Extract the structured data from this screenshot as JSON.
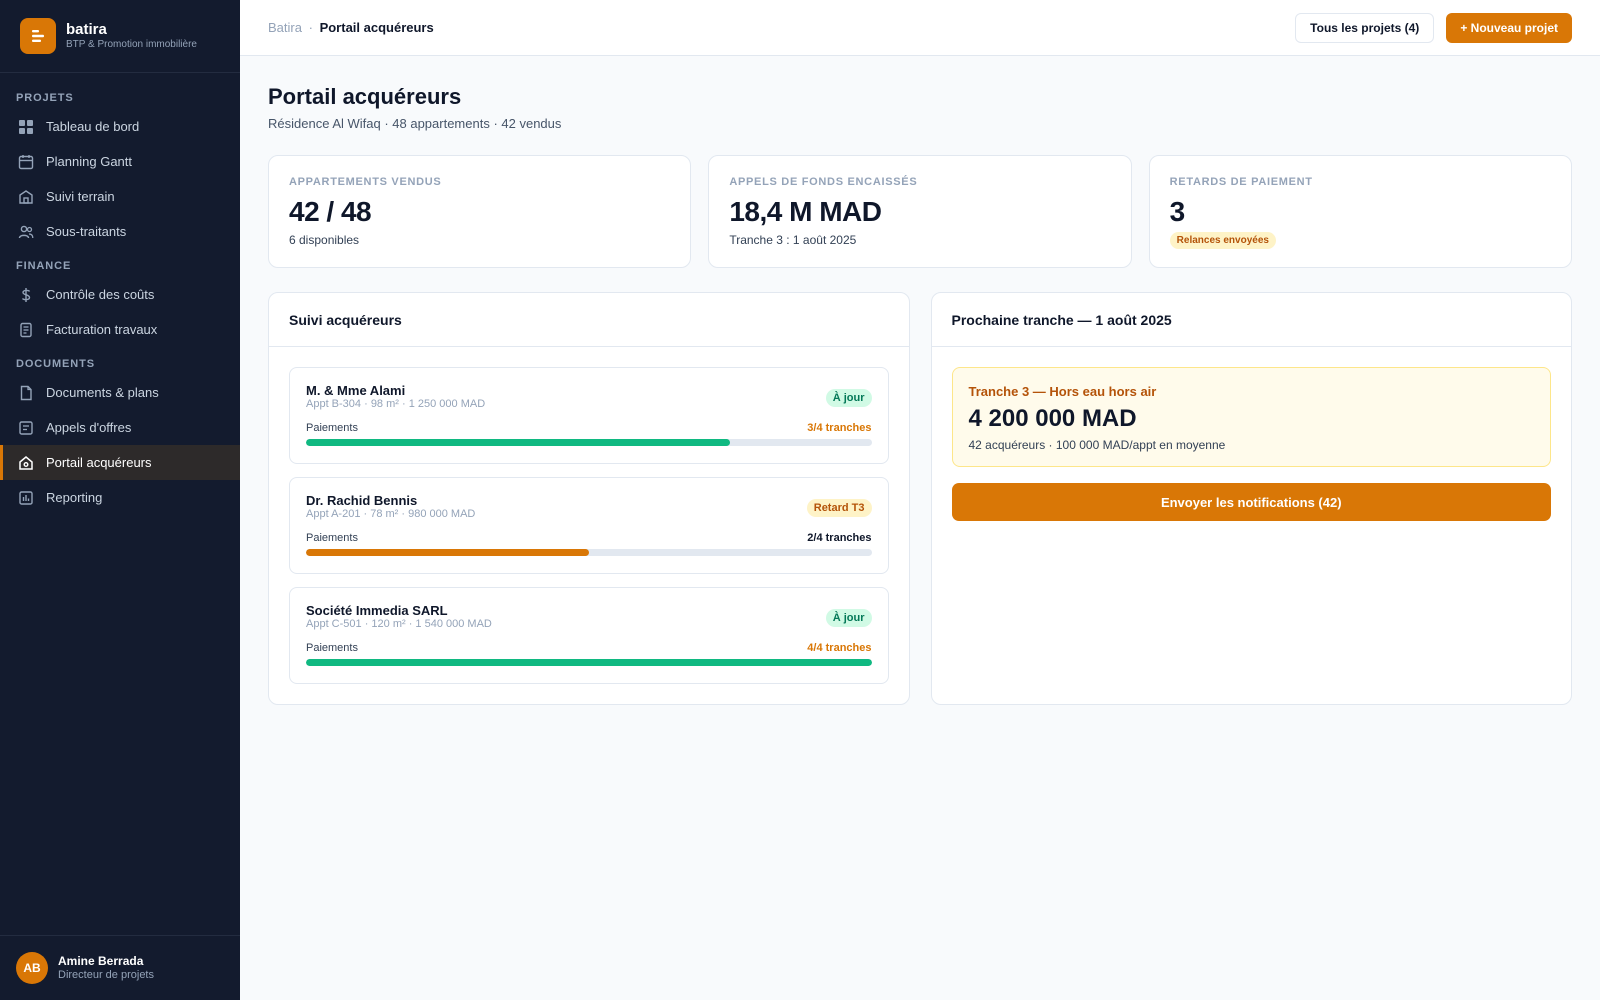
{
  "brand": {
    "name": "batira",
    "tagline": "BTP & Promotion immobilière",
    "accent": "#d97706"
  },
  "sidebar": {
    "sections": [
      {
        "title": "PROJETS",
        "items": [
          {
            "label": "Tableau de bord",
            "icon": "grid-icon"
          },
          {
            "label": "Planning Gantt",
            "icon": "calendar-icon"
          },
          {
            "label": "Suivi terrain",
            "icon": "building-icon"
          },
          {
            "label": "Sous-traitants",
            "icon": "users-icon"
          }
        ]
      },
      {
        "title": "FINANCE",
        "items": [
          {
            "label": "Contrôle des coûts",
            "icon": "currency-icon"
          },
          {
            "label": "Facturation travaux",
            "icon": "invoice-icon"
          }
        ]
      },
      {
        "title": "DOCUMENTS",
        "items": [
          {
            "label": "Documents & plans",
            "icon": "file-icon"
          },
          {
            "label": "Appels d'offres",
            "icon": "form-icon"
          },
          {
            "label": "Portail acquéreurs",
            "icon": "home-icon",
            "active": true
          },
          {
            "label": "Reporting",
            "icon": "chart-icon"
          }
        ]
      }
    ]
  },
  "user": {
    "initials": "AB",
    "name": "Amine Berrada",
    "role": "Directeur de projets"
  },
  "topbar": {
    "breadcrumb_root": "Batira",
    "breadcrumb_sep": "·",
    "breadcrumb_current": "Portail acquéreurs",
    "all_projects_label": "Tous les projets (4)",
    "new_project_label": "+ Nouveau projet"
  },
  "page": {
    "title": "Portail acquéreurs",
    "subtitle": "Résidence Al Wifaq · 48 appartements · 42 vendus"
  },
  "kpis": [
    {
      "label": "APPARTEMENTS VENDUS",
      "value": "42 / 48",
      "note": "6 disponibles"
    },
    {
      "label": "APPELS DE FONDS ENCAISSÉS",
      "value": "18,4 M MAD",
      "note": "Tranche 3 : 1 août 2025"
    },
    {
      "label": "RETARDS DE PAIEMENT",
      "value": "3",
      "badge": "Relances envoyées"
    }
  ],
  "buyers_panel": {
    "title": "Suivi acquéreurs",
    "payments_label": "Paiements",
    "buyers": [
      {
        "name": "M. & Mme Alami",
        "meta": "Appt B-304 · 98 m² · 1 250 000 MAD",
        "status": "À jour",
        "status_kind": "ok",
        "tranches": "3/4 tranches",
        "progress": 0.75,
        "bar_color": "#10b981",
        "count_color": "amber"
      },
      {
        "name": "Dr. Rachid Bennis",
        "meta": "Appt A-201 · 78 m² · 980 000 MAD",
        "status": "Retard T3",
        "status_kind": "late",
        "tranches": "2/4 tranches",
        "progress": 0.5,
        "bar_color": "#d97706",
        "count_color": "dark"
      },
      {
        "name": "Société Immedia SARL",
        "meta": "Appt C-501 · 120 m² · 1 540 000 MAD",
        "status": "À jour",
        "status_kind": "ok",
        "tranches": "4/4 tranches",
        "progress": 1.0,
        "bar_color": "#10b981",
        "count_color": "amber"
      }
    ]
  },
  "tranche_panel": {
    "title": "Prochaine tranche — 1 août 2025",
    "box_title": "Tranche 3 — Hors eau hors air",
    "amount": "4 200 000 MAD",
    "note": "42 acquéreurs · 100 000 MAD/appt en moyenne",
    "button_label": "Envoyer les notifications (42)"
  }
}
